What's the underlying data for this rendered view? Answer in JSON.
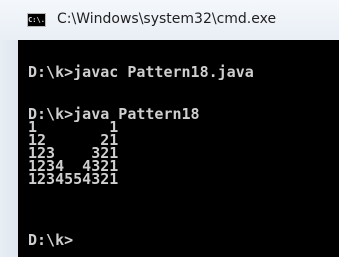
{
  "window": {
    "title": "C:\\Windows\\system32\\cmd.exe",
    "icon": "cmd-console-icon",
    "icon_text": "C:\\."
  },
  "console": {
    "lines": [
      "D:\\k>javac Pattern18.java",
      "D:\\k>java Pattern18",
      "1        1",
      "12      21",
      "123    321",
      "1234  4321",
      "1234554321",
      "D:\\k>"
    ]
  }
}
